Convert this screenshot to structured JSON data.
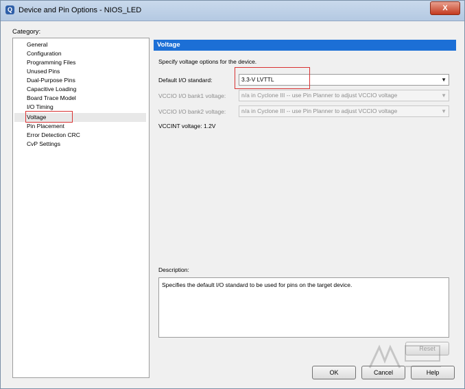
{
  "window": {
    "title": "Device and Pin Options - NIOS_LED",
    "close_glyph": "X"
  },
  "category": {
    "label": "Category:",
    "items": [
      "General",
      "Configuration",
      "Programming Files",
      "Unused Pins",
      "Dual-Purpose Pins",
      "Capacitive Loading",
      "Board Trace Model",
      "I/O Timing",
      "Voltage",
      "Pin Placement",
      "Error Detection CRC",
      "CvP Settings"
    ],
    "selected": "Voltage"
  },
  "panel": {
    "header": "Voltage",
    "intro": "Specify voltage options for the device.",
    "default_io_label": "Default I/O standard:",
    "default_io_value": "3.3-V LVTTL",
    "vccio1_label": "VCCIO I/O bank1 voltage:",
    "vccio1_value": "n/a in Cyclone III -- use Pin Planner to adjust VCCIO voltage",
    "vccio2_label": "VCCIO I/O bank2 voltage:",
    "vccio2_value": "n/a in Cyclone III -- use Pin Planner to adjust VCCIO voltage",
    "vccint": "VCCINT voltage: 1.2V",
    "description_label": "Description:",
    "description_text": "Specifies the default I/O standard to be used for pins on the target device."
  },
  "buttons": {
    "reset": "Reset",
    "ok": "OK",
    "cancel": "Cancel",
    "help": "Help"
  },
  "icons": {
    "app": "quartus-app-icon",
    "dropdown": "chevron-down-icon"
  },
  "colors": {
    "header_bg": "#1c6fd6",
    "highlight_border": "#d83030",
    "close_button": "#c43b1f"
  }
}
